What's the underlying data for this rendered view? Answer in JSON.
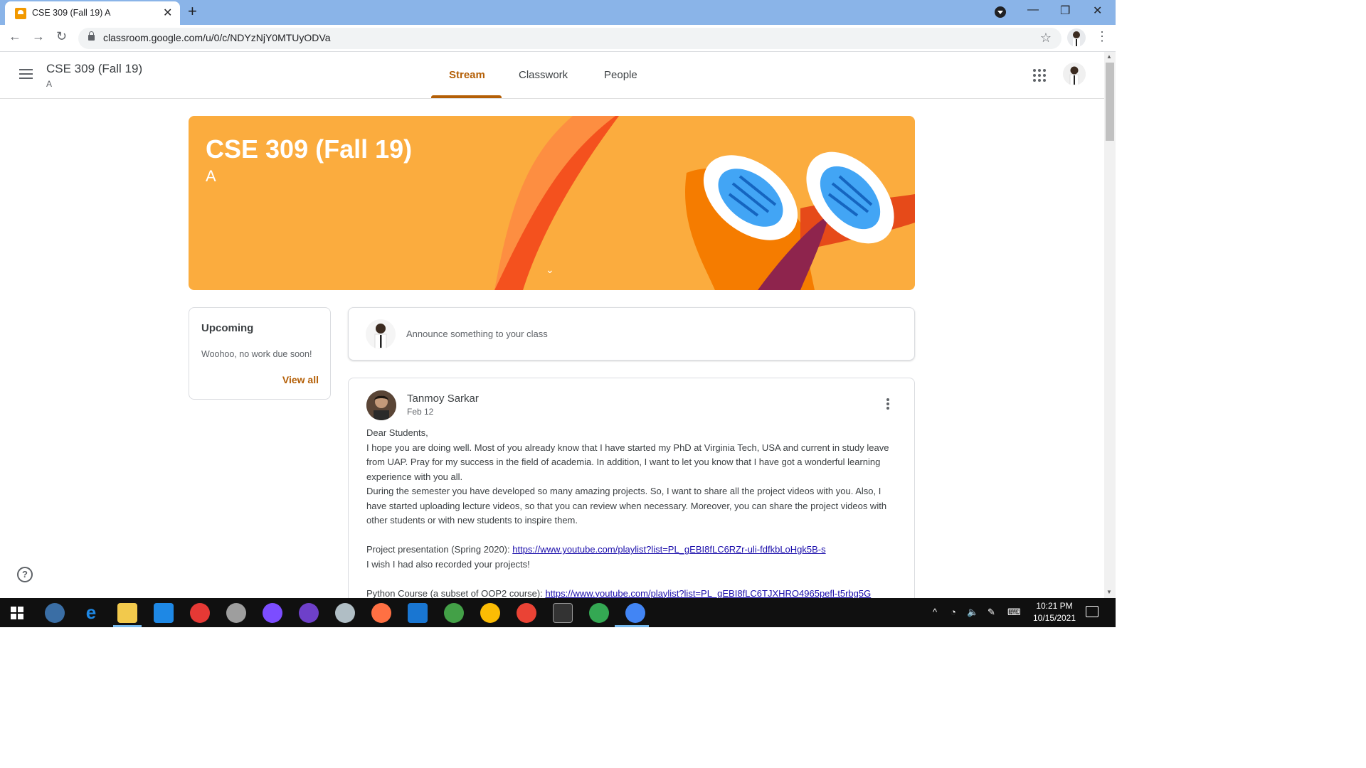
{
  "browser": {
    "tab_title": "CSE 309 (Fall 19) A",
    "url": "classroom.google.com/u/0/c/NDYzNjY0MTUyODVa"
  },
  "header": {
    "course_title": "CSE 309 (Fall 19)",
    "section": "A",
    "tabs": [
      {
        "label": "Stream",
        "active": true
      },
      {
        "label": "Classwork",
        "active": false
      },
      {
        "label": "People",
        "active": false
      }
    ]
  },
  "banner": {
    "title": "CSE 309 (Fall 19)",
    "section": "A",
    "color": "#fbac3e"
  },
  "upcoming": {
    "title": "Upcoming",
    "text": "Woohoo, no work due soon!",
    "link": "View all"
  },
  "announce": {
    "placeholder": "Announce something to your class"
  },
  "post": {
    "author": "Tanmoy Sarkar",
    "date": "Feb 12",
    "greeting": "Dear Students,",
    "para1": "I hope you are doing well. Most of you already know that I have started my PhD at Virginia Tech, USA and current in study leave from UAP. Pray for my success in the field of academia. In addition, I want to let you know that I have got a wonderful learning experience with you all.",
    "para2": "During the semester you have developed so many amazing projects. So, I want to share all the project videos with you. Also, I have started uploading lecture videos, so that you can review when necessary. Moreover, you can share the project videos with other students or with new students to inspire them.",
    "project_label": "Project presentation (Spring 2020): ",
    "project_link": "https://www.youtube.com/playlist?list=PL_gEBI8fLC6RZr-uli-fdfkbLoHgk5B-s",
    "wish": "I wish I had also recorded your projects!",
    "python_label": "Python Course (a subset of OOP2 course): ",
    "python_link": "https://www.youtube.com/playlist?list=PL_gEBI8fLC6TJXHRO4965pefl-t5rbg5G"
  },
  "taskbar": {
    "time": "10:21 PM",
    "date": "10/15/2021"
  },
  "colors": {
    "accent": "#b45f06",
    "link": "#1a0dab"
  }
}
